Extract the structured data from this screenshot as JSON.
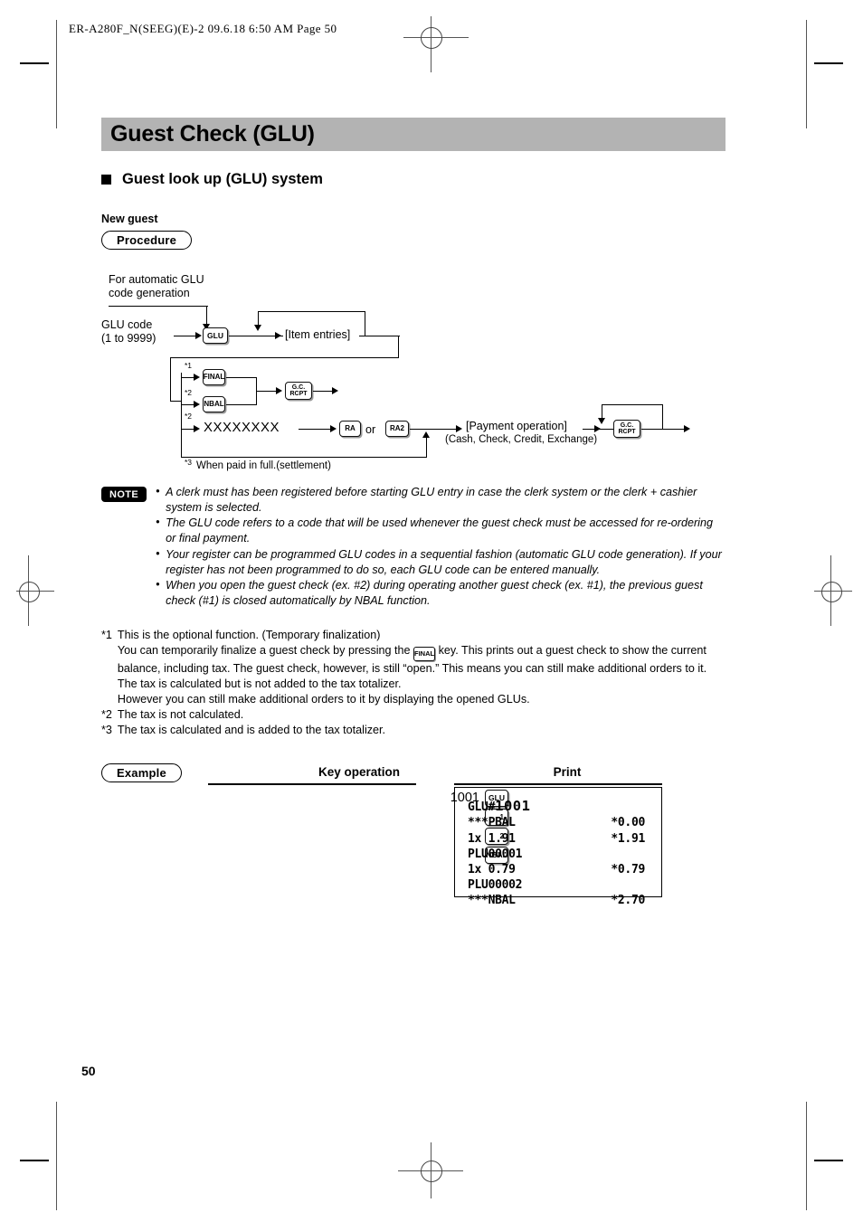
{
  "page": {
    "slug": "ER-A280F_N(SEEG)(E)-2   09.6.18 6:50 AM   Page 50",
    "number": "50"
  },
  "title": "Guest Check (GLU)",
  "section": {
    "heading": "Guest look up (GLU) system",
    "subheading": "New guest",
    "procedure_label": "Procedure"
  },
  "flow": {
    "auto_note_line1": "For automatic GLU",
    "auto_note_line2": "code generation",
    "glu_code_line1": "GLU code",
    "glu_code_line2": "(1 to 9999)",
    "key_glu": "GLU",
    "item_entries": "[Item entries]",
    "key_final": "FINAL",
    "key_nbal": "NBAL",
    "key_gc_rcpt_top": "G.C.",
    "key_gc_rcpt_bottom": "RCPT",
    "amount_placeholder": "XXXXXXXX",
    "key_ra": "RA",
    "or_label": "or",
    "key_ra2": "RA2",
    "payment_line1": "[Payment operation]",
    "payment_line2": "(Cash, Check, Credit, Exchange)",
    "sup1": "*1",
    "sup2a": "*2",
    "sup2b": "*2",
    "sup3": "*3",
    "settlement_note": "When paid in full.(settlement)"
  },
  "note": {
    "badge": "NOTE",
    "items": [
      "A clerk must has been registered before starting GLU entry in case the clerk system or the clerk + cashier system is selected.",
      "The GLU code refers to a code that will be used whenever the guest check must be accessed for re-ordering or final payment.",
      "Your register can be programmed GLU codes in a sequential fashion (automatic GLU code generation). If your register has not been programmed to do so, each GLU code can be entered manually.",
      "When you open the guest check (ex. #2) during operating another guest check (ex. #1), the previous guest check (#1) is closed automatically by NBAL function."
    ]
  },
  "footnotes": {
    "f1_mark": "*1",
    "f1_line1": "This is the optional function. (Temporary finalization)",
    "f1_line2a": "You can temporarily finalize a guest check by pressing the",
    "f1_key": "FINAL",
    "f1_line2b": "key. This prints out a guest check to show the current balance, including tax. The guest check, however, is still “open.” This means you can still make additional orders to it. The tax is calculated but is not added to the tax totalizer.",
    "f1_line3": "However you can still make additional orders to it by displaying the opened GLUs.",
    "f2_mark": "*2",
    "f2_text": "The tax is not calculated.",
    "f3_mark": "*3",
    "f3_text": "The tax is calculated and is added to the tax totalizer."
  },
  "example": {
    "label": "Example",
    "key_operation_header": "Key operation",
    "print_header": "Print",
    "key_operation": [
      {
        "num": "1001",
        "key": "GLU",
        "type": "fn"
      },
      {
        "num": "",
        "key": "1",
        "type": "num"
      },
      {
        "num": "",
        "key": "2",
        "type": "num"
      },
      {
        "num": "",
        "key": "NBAL",
        "type": "fn"
      }
    ],
    "print": {
      "lines": [
        {
          "left": "GLU#",
          "big": "1001",
          "right": ""
        },
        {
          "left": "***PBAL",
          "right": "*0.00"
        },
        {
          "left": "1x 1.91",
          "right": "*1.91"
        },
        {
          "left": "PLU00001",
          "right": ""
        },
        {
          "left": "1x 0.79",
          "right": "*0.79"
        },
        {
          "left": "PLU00002",
          "right": ""
        },
        {
          "left": "***NBAL",
          "right": "*2.70"
        }
      ]
    }
  },
  "colors": {
    "title_bar": "#b3b3b3",
    "text": "#000000",
    "key_shadow": "#9a9a9a"
  }
}
